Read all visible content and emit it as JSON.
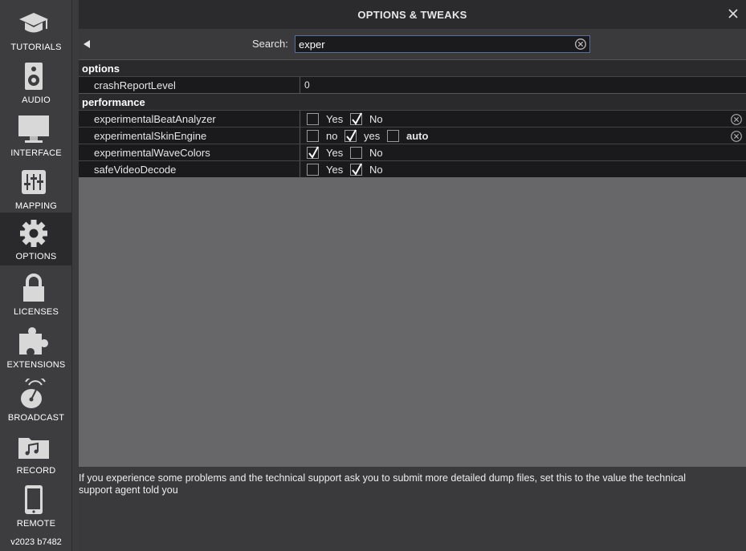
{
  "sidebar": {
    "items": [
      {
        "label": "TUTORIALS",
        "icon": "graduation-cap-icon",
        "active": false
      },
      {
        "label": "AUDIO",
        "icon": "speaker-icon",
        "active": false
      },
      {
        "label": "INTERFACE",
        "icon": "monitor-icon",
        "active": false
      },
      {
        "label": "MAPPING",
        "icon": "sliders-icon",
        "active": false
      },
      {
        "label": "OPTIONS",
        "icon": "gear-icon",
        "active": true
      },
      {
        "label": "LICENSES",
        "icon": "lock-icon",
        "active": false
      },
      {
        "label": "EXTENSIONS",
        "icon": "puzzle-icon",
        "active": false
      },
      {
        "label": "BROADCAST",
        "icon": "satellite-dish-icon",
        "active": false
      },
      {
        "label": "RECORD",
        "icon": "music-folder-icon",
        "active": false
      },
      {
        "label": "REMOTE",
        "icon": "phone-icon",
        "active": false
      }
    ],
    "version": "v2023 b7482"
  },
  "header": {
    "title": "OPTIONS & TWEAKS"
  },
  "search": {
    "label": "Search:",
    "value": "exper"
  },
  "groups": {
    "options": {
      "label": "options",
      "rows": [
        {
          "name": "crashReportLevel",
          "value": "0"
        }
      ]
    },
    "performance": {
      "label": "performance",
      "rows": [
        {
          "name": "experimentalBeatAnalyzer",
          "options": [
            {
              "label": "Yes",
              "checked": false
            },
            {
              "label": "No",
              "checked": true
            }
          ]
        },
        {
          "name": "experimentalSkinEngine",
          "options": [
            {
              "label": "no",
              "checked": false
            },
            {
              "label": "yes",
              "checked": true
            },
            {
              "label": "auto",
              "checked": false
            }
          ]
        },
        {
          "name": "experimentalWaveColors",
          "options": [
            {
              "label": "Yes",
              "checked": true
            },
            {
              "label": "No",
              "checked": false
            }
          ]
        },
        {
          "name": "safeVideoDecode",
          "options": [
            {
              "label": "Yes",
              "checked": false
            },
            {
              "label": "No",
              "checked": true
            }
          ]
        }
      ]
    }
  },
  "description": "If you experience some problems and the technical support ask you to submit more detailed dump files, set this to the value the technical support agent told you",
  "colors": {
    "panel_bg": "#3b3b3e",
    "row_bg": "#1a1a1c",
    "group_bg": "#2a2a2c",
    "empty_table_bg": "#676769",
    "accent_border": "#5a6e9a"
  }
}
